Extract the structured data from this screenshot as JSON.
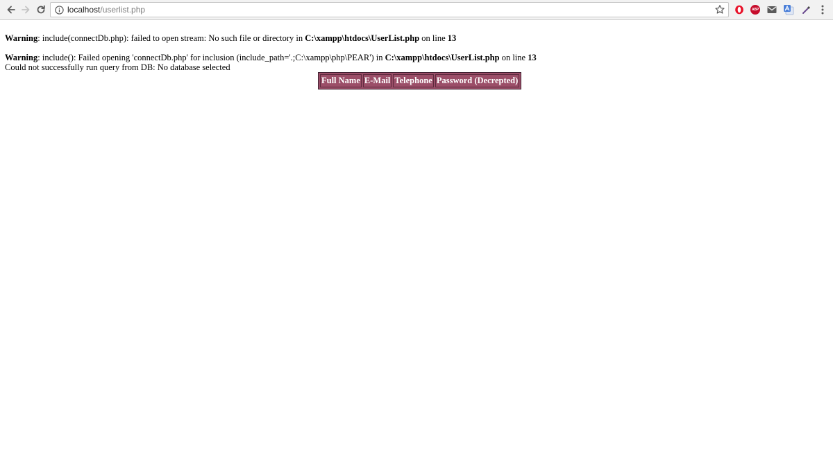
{
  "browser": {
    "url_host": "localhost",
    "url_path": "/userlist.php"
  },
  "extensions": {
    "abp_label": "ABP"
  },
  "page": {
    "warning1": {
      "label": "Warning",
      "text_a": ": include(connectDb.php): failed to open stream: No such file or directory in ",
      "file": "C:\\xampp\\htdocs\\UserList.php",
      "text_b": " on line ",
      "line": "13"
    },
    "warning2": {
      "label": "Warning",
      "text_a": ": include(): Failed opening 'connectDb.php' for inclusion (include_path='.;C:\\xampp\\php\\PEAR') in ",
      "file": "C:\\xampp\\htdocs\\UserList.php",
      "text_b": " on line ",
      "line": "13"
    },
    "query_error": "Could not successfully run query from DB: No database selected",
    "table": {
      "headers": [
        "Full Name",
        "E-Mail",
        "Telephone",
        "Password (Decrepted)"
      ]
    }
  },
  "colors": {
    "table_header_bg": "#9b4e68",
    "table_header_text": "#ffffff",
    "abp_red": "#c70d2c"
  }
}
